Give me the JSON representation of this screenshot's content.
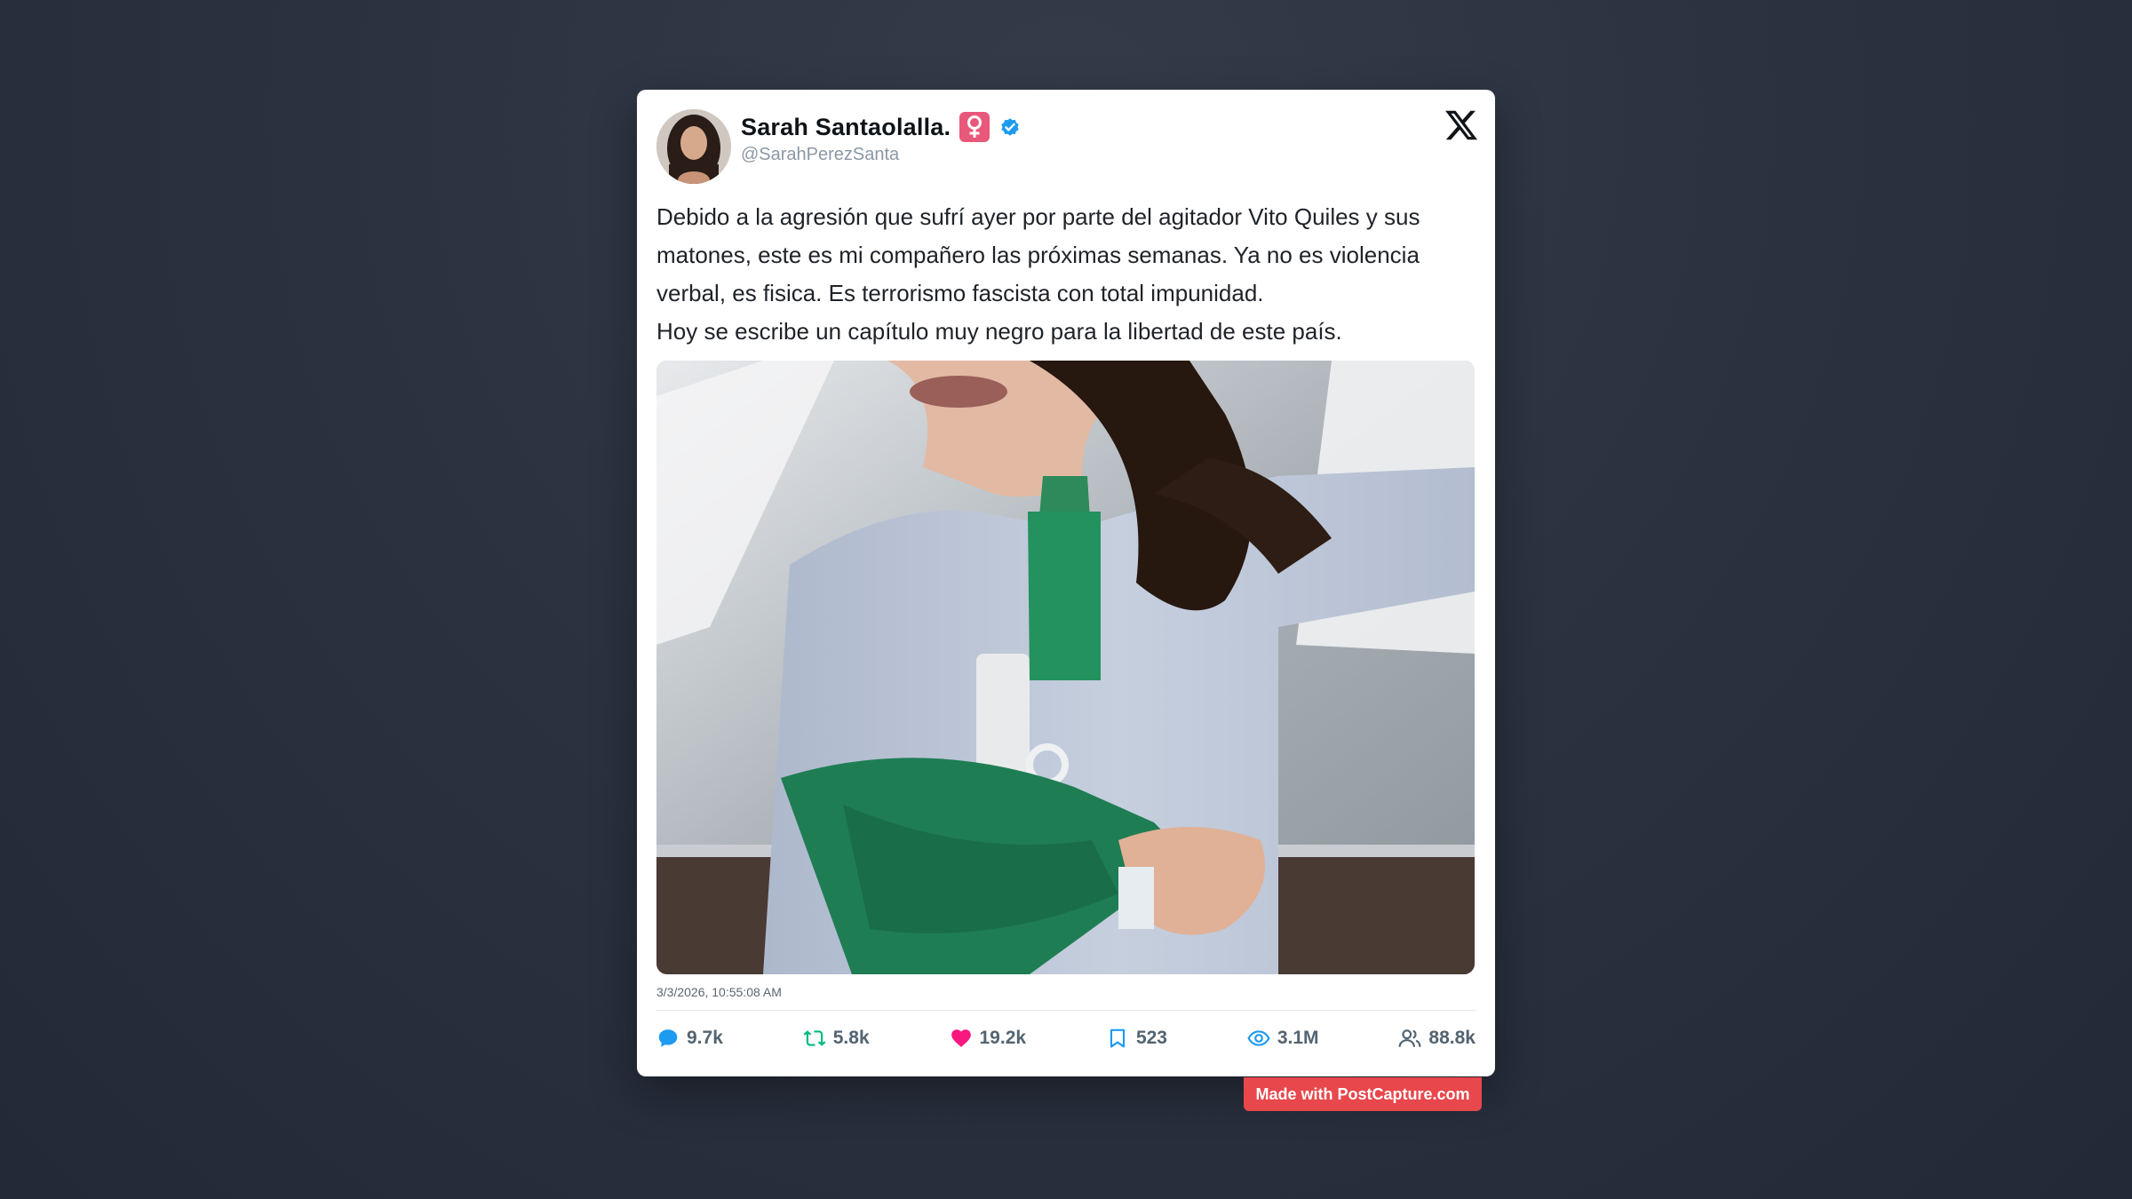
{
  "post": {
    "author": {
      "display_name": "Sarah Santaolalla.",
      "emoji": "female-sign-emoji",
      "verified": true,
      "handle": "@SarahPerezSanta"
    },
    "text_lines": [
      "Debido a la agresión que sufrí ayer por parte del agitador Vito Quiles y sus matones, este es mi compañero las próximas semanas. Ya no es violencia verbal, es fisica. Es terrorismo fascista con total impunidad.",
      "Hoy se escribe un capítulo muy negro para la libertad de este país."
    ],
    "timestamp": "3/3/2026, 10:55:08 AM",
    "stats": {
      "replies": "9.7k",
      "reposts": "5.8k",
      "likes": "19.2k",
      "bookmarks": "523",
      "views": "3.1M",
      "followers": "88.8k"
    }
  },
  "watermark": "Made with PostCapture.com",
  "colors": {
    "reply": "#1d9bf0",
    "repost": "#00ba7c",
    "like": "#f91880",
    "bookmark": "#1d9bf0",
    "views": "#1d9bf0",
    "followers": "#536471",
    "watermark": "#e8474c",
    "verified": "#1d9bf0"
  }
}
